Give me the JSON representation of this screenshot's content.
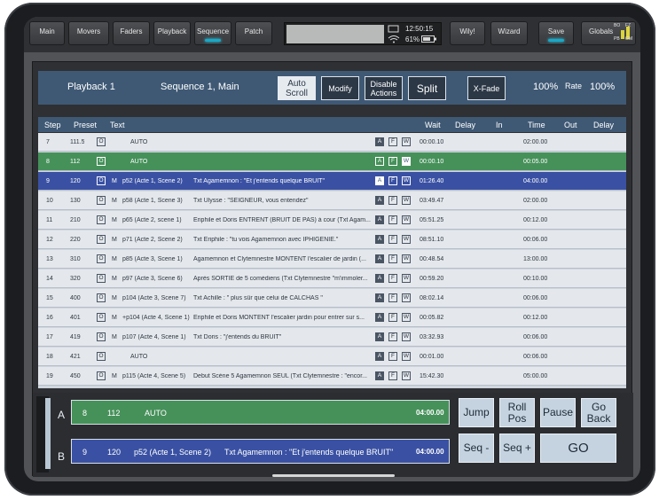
{
  "topbar": {
    "buttons": [
      "Main",
      "Movers",
      "Faders",
      "Playback",
      "Sequence",
      "Patch",
      "Wily!",
      "Wizard",
      "Save",
      "Globals"
    ],
    "time": "12:50:15",
    "battery": "61%",
    "globals_tags": [
      "BO",
      "FZ",
      "PB",
      "GM"
    ]
  },
  "header": {
    "playback": "Playback 1",
    "sequence": "Sequence 1, Main",
    "auto_scroll": "Auto Scroll",
    "modify": "Modify",
    "disable_actions": "Disable Actions",
    "split": "Split",
    "xfade": "X-Fade",
    "percent": "100%",
    "rate_label": "Rate",
    "rate_value": "100%"
  },
  "columns": [
    "Step",
    "Preset",
    "Text",
    "Wait",
    "Delay",
    "In",
    "Time",
    "Out",
    "Delay"
  ],
  "rows": [
    {
      "step": "7",
      "preset": "111.5",
      "m": "",
      "scene": "",
      "text": "AUTO",
      "wait": "00:00.10",
      "time": "02:00.00"
    },
    {
      "step": "8",
      "preset": "112",
      "m": "",
      "scene": "",
      "text": "AUTO",
      "wait": "00:00.10",
      "time": "00:05.00"
    },
    {
      "step": "9",
      "preset": "120",
      "m": "M",
      "scene": "p52 (Acte 1, Scene 2)",
      "text": "Txt Agamemnon : \"Et j'entends quelque BRUIT\"",
      "wait": "01:26.40",
      "time": "04:00.00"
    },
    {
      "step": "10",
      "preset": "130",
      "m": "M",
      "scene": "p58 (Acte 1, Scene 3)",
      "text": "Txt Ulysse : \"SEIGNEUR, vous entendez\"",
      "wait": "03:49.47",
      "time": "02:00.00"
    },
    {
      "step": "11",
      "preset": "210",
      "m": "M",
      "scene": "p65 (Acte 2, scene 1)",
      "text": "Eriphile et Doris ENTRENT (BRUIT DE PAS) à cour (Txt Agam...",
      "wait": "05:51.25",
      "time": "00:12.00"
    },
    {
      "step": "12",
      "preset": "220",
      "m": "M",
      "scene": "p71 (Acte 2, Scene 2)",
      "text": "Txt Eriphile : \"tu vois Agamemnon avec IPHIGENIE.\"",
      "wait": "08:51.10",
      "time": "00:06.00"
    },
    {
      "step": "13",
      "preset": "310",
      "m": "M",
      "scene": "p85 (Acte 3, Scene 1)",
      "text": "Agamemnon et Clytemnestre MONTENT l'escalier de jardin (...",
      "wait": "00:48.54",
      "time": "13:00.00"
    },
    {
      "step": "14",
      "preset": "320",
      "m": "M",
      "scene": "p97 (Acte 3, Scene 6)",
      "text": "Après SORTIE de 5 comédiens (Txt Clytemnestre \"m'immoler...",
      "wait": "00:59.20",
      "time": "00:10.00"
    },
    {
      "step": "15",
      "preset": "400",
      "m": "M",
      "scene": "p104 (Acte 3, Scene 7)",
      "text": "Txt Achille : \" plus sûr que celui de CALCHAS \"",
      "wait": "08:02.14",
      "time": "00:06.00"
    },
    {
      "step": "16",
      "preset": "401",
      "m": "M",
      "scene": "+p104 (Acte 4, Scene 1)",
      "text": "Eriphile et Doris MONTENT l'escalier jardin pour entrer sur s...",
      "wait": "00:05.82",
      "time": "00:12.00"
    },
    {
      "step": "17",
      "preset": "419",
      "m": "M",
      "scene": "p107 (Acte 4, Scene 1)",
      "text": "Txt Doris : \"j'entends du BRUIT\"",
      "wait": "03:32.93",
      "time": "00:06.00"
    },
    {
      "step": "18",
      "preset": "421",
      "m": "",
      "scene": "",
      "text": "AUTO",
      "wait": "00:01.00",
      "time": "00:06.00"
    },
    {
      "step": "19",
      "preset": "450",
      "m": "M",
      "scene": "p115 (Acte 4, Scene 5)",
      "text": "Debut Scène 5 Agamemnon SEUL (Txt Clytemnestre : \"encor...",
      "wait": "15:42.30",
      "time": "05:00.00"
    }
  ],
  "flags": {
    "o": "O",
    "a": "A",
    "f": "F",
    "w": "W"
  },
  "playback_a": {
    "label": "A",
    "step": "8",
    "preset": "112",
    "text": "AUTO",
    "time": "04:00.00"
  },
  "playback_b": {
    "label": "B",
    "step": "9",
    "preset": "120",
    "scene": "p52 (Acte 1, Scene 2)",
    "text": "Txt Agamemnon : \"Et j'entends quelque BRUIT\"",
    "time": "04:00.00"
  },
  "controls": {
    "jump": "Jump",
    "roll_pos": "Roll Pos",
    "pause": "Pause",
    "go_back": "Go Back",
    "seq_minus": "Seq -",
    "seq_plus": "Seq +",
    "go": "GO"
  },
  "colors": {
    "current_row": "#46915a",
    "next_row": "#3a51a3",
    "accent": "#16a9c9"
  }
}
